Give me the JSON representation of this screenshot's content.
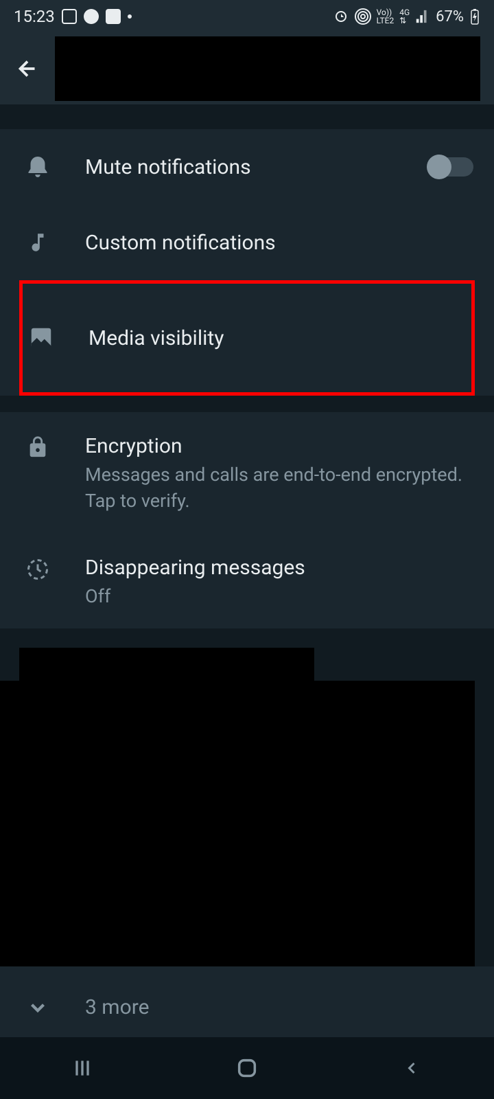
{
  "status_bar": {
    "time": "15:23",
    "battery": "67%",
    "network_label": "4G",
    "lte_label": "LTE2",
    "vo_label": "Vo))"
  },
  "settings": {
    "mute_notifications": "Mute notifications",
    "custom_notifications": "Custom notifications",
    "media_visibility": "Media visibility",
    "encryption": {
      "title": "Encryption",
      "subtitle": "Messages and calls are end-to-end encrypted. Tap to verify."
    },
    "disappearing_messages": {
      "title": "Disappearing messages",
      "subtitle": "Off"
    },
    "more": "3 more"
  }
}
